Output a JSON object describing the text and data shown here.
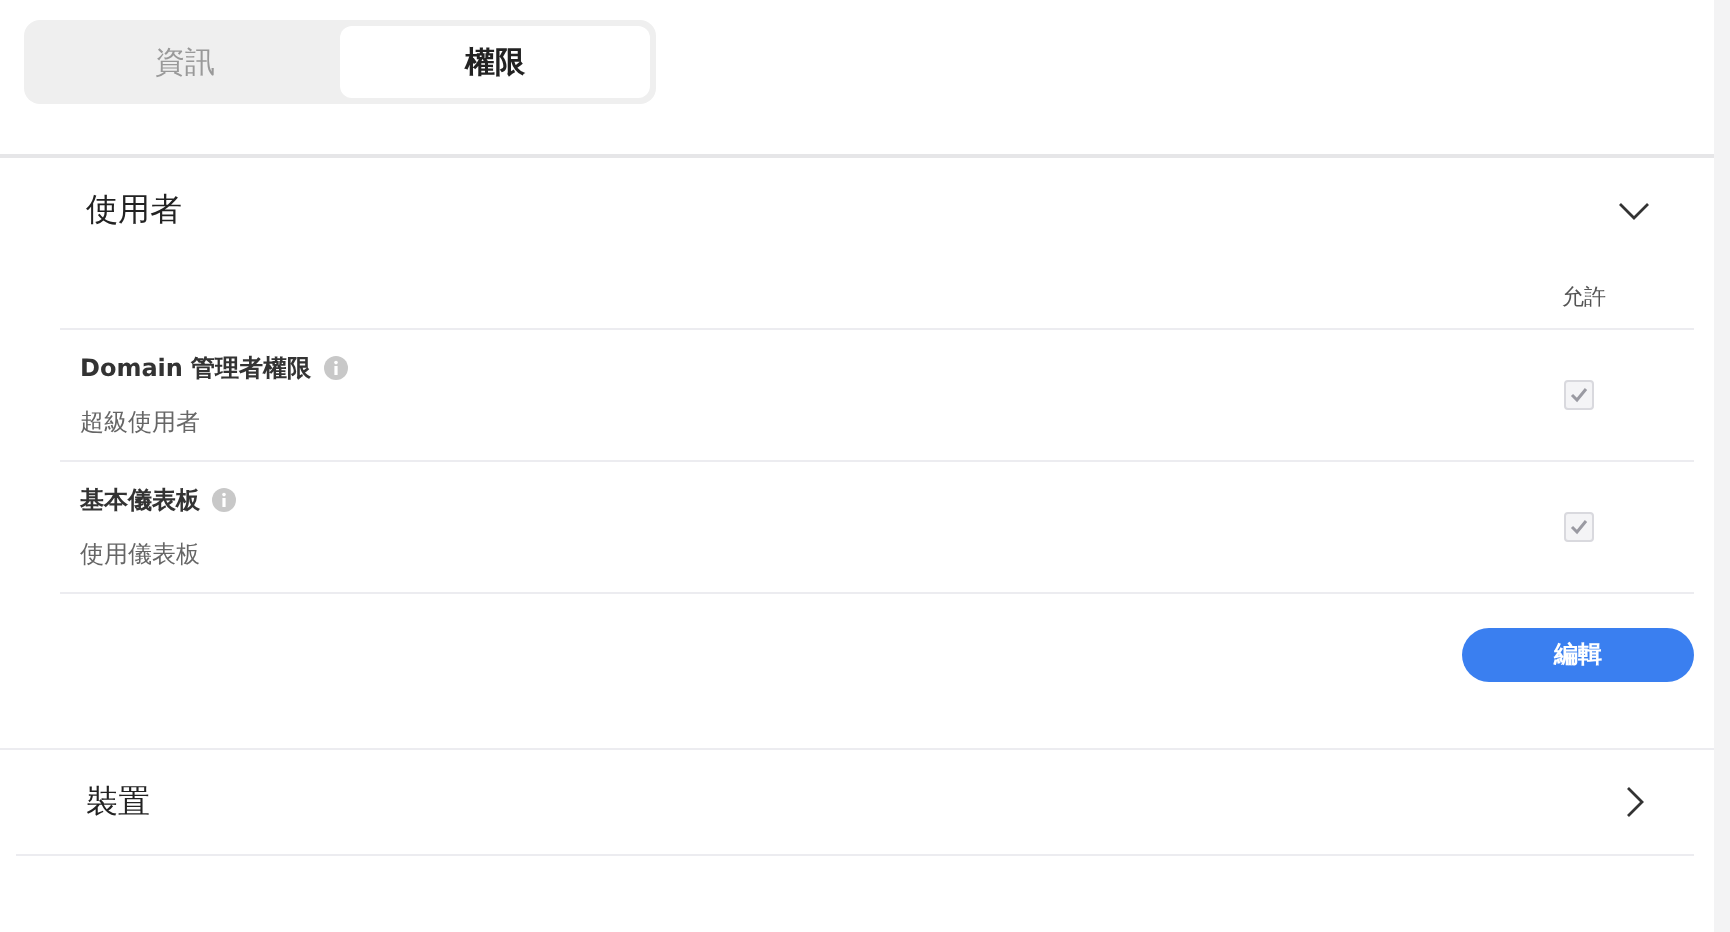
{
  "tabs": [
    {
      "label": "資訊",
      "selected": false
    },
    {
      "label": "權限",
      "selected": true
    }
  ],
  "sections": [
    {
      "title": "使用者",
      "expanded": true,
      "column_header": "允許",
      "rows": [
        {
          "name": "Domain 管理者權限",
          "description": "超級使用者",
          "checked": true,
          "disabled": true
        },
        {
          "name": "基本儀表板",
          "description": "使用儀表板",
          "checked": true,
          "disabled": true
        }
      ],
      "button": "編輯"
    },
    {
      "title": "裝置",
      "expanded": false
    }
  ]
}
